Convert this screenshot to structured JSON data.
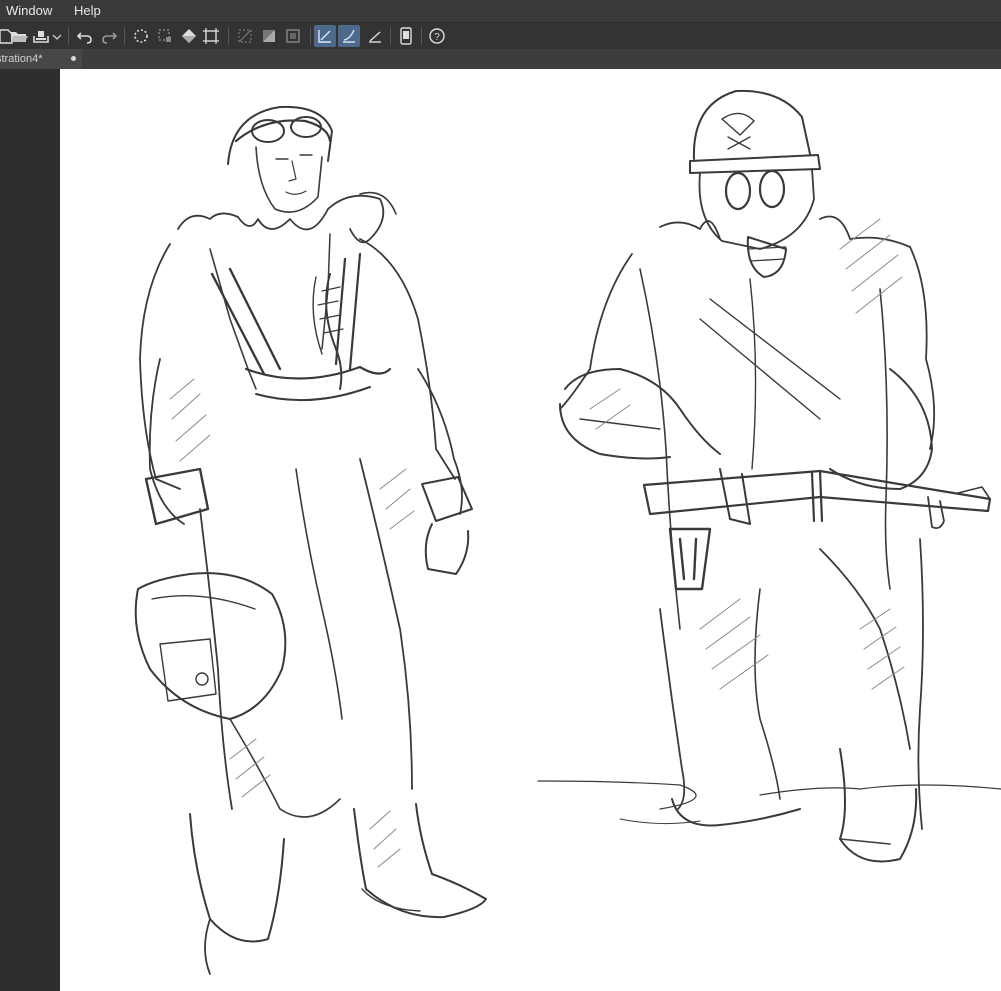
{
  "menu": {
    "items": [
      "Window",
      "Help"
    ]
  },
  "toolbar": {
    "icons": [
      "new-file-icon",
      "open-folder-icon",
      "save-icon",
      "save-dropdown-icon",
      "undo-icon",
      "redo-icon",
      "deselect-icon",
      "clear-selection-icon",
      "fill-icon",
      "transform-icon",
      "hide-selection-icon",
      "invert-selection-icon",
      "crop-icon",
      "snap-to-ruler-icon",
      "snap-to-special-ruler-icon",
      "snap-to-grid-icon",
      "smartphone-companion-icon",
      "help-icon"
    ]
  },
  "tab": {
    "title": "stration4*"
  },
  "colors": {
    "menubar_bg": "#3a3a3a",
    "toolbar_bg": "#333333",
    "active_tool": "#4d6a8c",
    "canvas_bg": "#ffffff",
    "workspace_bg": "#2e2e2e",
    "sketch_stroke": "#3a3a3a"
  }
}
